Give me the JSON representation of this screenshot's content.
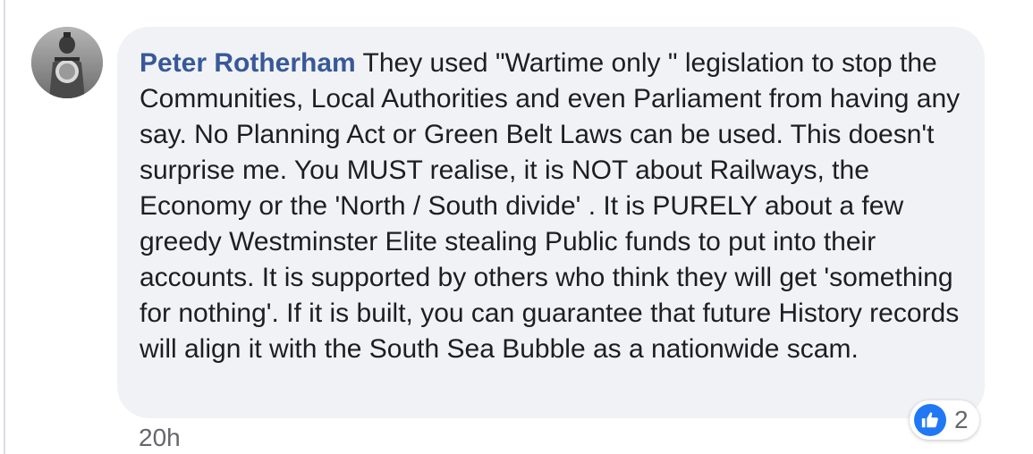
{
  "comment": {
    "author": "Peter Rotherham",
    "text": "They used \"Wartime only \" legislation to stop the Communities, Local Authorities and even Parliament from having any say. No Planning Act or Green Belt Laws can be used. This doesn't surprise me. You MUST realise, it is NOT about Railways, the Economy or the 'North / South divide' . It is PURELY about a few greedy Westminster Elite stealing Public funds to put into their accounts. It is supported by others who think they will get 'something for nothing'. If it is built, you can guarantee that future History records will align it with the South Sea Bubble as a nationwide scam.",
    "timestamp": "20h",
    "reaction_count": "2",
    "reaction_icon": "like-icon"
  },
  "colors": {
    "author": "#385898",
    "bubble": "#f0f2f5",
    "like": "#2078f4",
    "meta": "#65676b"
  }
}
